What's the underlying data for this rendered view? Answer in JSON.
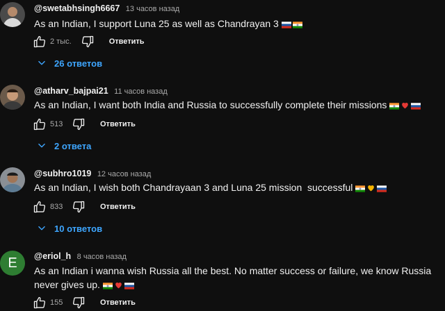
{
  "comments": [
    {
      "author": "@swetabhsingh6667",
      "time": "13 часов назад",
      "text": "As an Indian, I support Luna 25 as well as Chandrayan 3",
      "likes": "2 тыс.",
      "reply_label": "Ответить",
      "replies_label": "26 ответов",
      "avatar_letter": ""
    },
    {
      "author": "@atharv_bajpai21",
      "time": "11 часов назад",
      "text": "As an Indian, I want both India and Russia to successfully complete their missions",
      "likes": "513",
      "reply_label": "Ответить",
      "replies_label": "2 ответа",
      "avatar_letter": ""
    },
    {
      "author": "@subhro1019",
      "time": "12 часов назад",
      "text": "As an Indian, I wish both Chandrayaan 3 and Luna 25 mission  successful",
      "likes": "833",
      "reply_label": "Ответить",
      "replies_label": "10 ответов",
      "avatar_letter": ""
    },
    {
      "author": "@eriol_h",
      "time": "8 часов назад",
      "text": "As an Indian i wanna wish Russia all the best. No matter success or failure, we know Russia never gives up.",
      "likes": "155",
      "reply_label": "Ответить",
      "avatar_letter": "E"
    }
  ],
  "colors": {
    "background": "#0f0f0f",
    "link": "#3ea6ff",
    "avatar_e": "#2e7d32"
  }
}
